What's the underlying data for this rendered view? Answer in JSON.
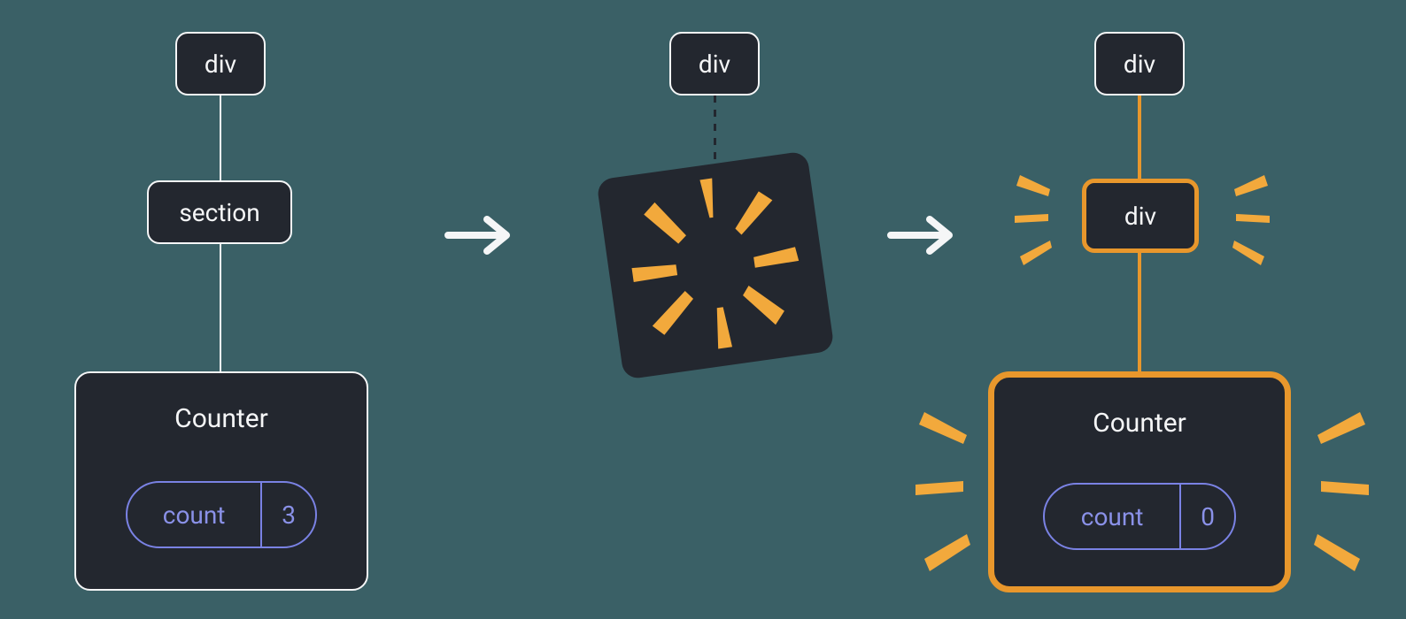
{
  "tree1": {
    "root": "div",
    "mid": "section",
    "leaf_title": "Counter",
    "pill_label": "count",
    "pill_value": "3"
  },
  "tree2": {
    "root": "div"
  },
  "tree3": {
    "root": "div",
    "mid": "div",
    "leaf_title": "Counter",
    "pill_label": "count",
    "pill_value": "0"
  },
  "colors": {
    "bg": "#3a6066",
    "node_bg": "#23272f",
    "node_border": "#f5f6f7",
    "accent": "#e8972c",
    "spark": "#f2a93c",
    "pill": "#7a82e4"
  }
}
